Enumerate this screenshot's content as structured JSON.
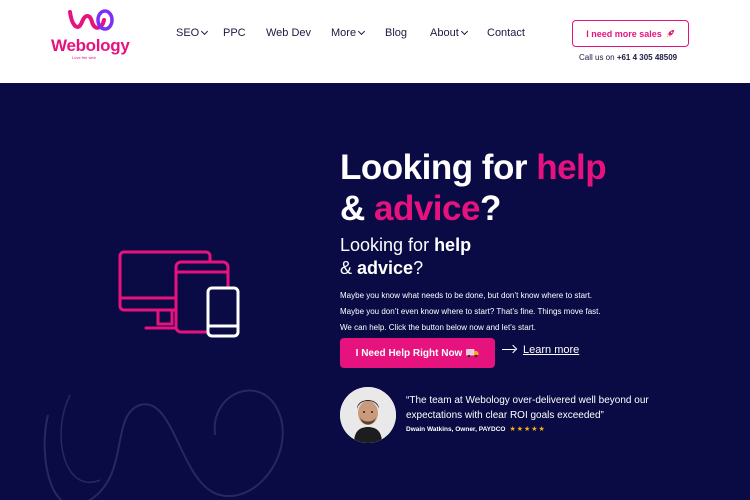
{
  "header": {
    "logo_text": "Webology",
    "logo_tagline": "Love the web",
    "nav": [
      {
        "label": "SEO",
        "dropdown": true
      },
      {
        "label": "PPC",
        "dropdown": false
      },
      {
        "label": "Web Dev",
        "dropdown": false
      },
      {
        "label": "More",
        "dropdown": true
      },
      {
        "label": "Blog",
        "dropdown": false
      },
      {
        "label": "About",
        "dropdown": true
      },
      {
        "label": "Contact",
        "dropdown": false
      }
    ],
    "cta_label": "I need more sales",
    "cta_icon": "rocket-icon",
    "call_prefix": "Call us on",
    "phone": "+61 4 305 48509"
  },
  "hero": {
    "title_part1": "Looking for ",
    "title_pink1": "help",
    "title_part2": "& ",
    "title_pink2": "advice",
    "title_part3": "?",
    "sub_part1": "Looking for ",
    "sub_bold1": "help",
    "sub_part2": "& ",
    "sub_bold2": "advice",
    "sub_part3": "?",
    "body_lines": [
      "Maybe you know what needs to be done, but don’t know where to start.",
      "Maybe you don’t even know where to start? That’s fine. Things move fast.",
      "We can help. Click the button below now and let’s start."
    ],
    "button_label": "I Need Help Right Now",
    "button_icon": "truck-icon",
    "learn_more": "Learn more"
  },
  "testimonial": {
    "quote": "“The team at Webology over-delivered well beyond our expectations with clear ROI goals exceeded”",
    "author": "Dwain Watkins, Owner, PAYDCO",
    "stars": "★★★★★",
    "rating": 5
  },
  "colors": {
    "brand_pink": "#e6137f",
    "navy_bg": "#0a0b44",
    "star_gold": "#f5b014"
  }
}
